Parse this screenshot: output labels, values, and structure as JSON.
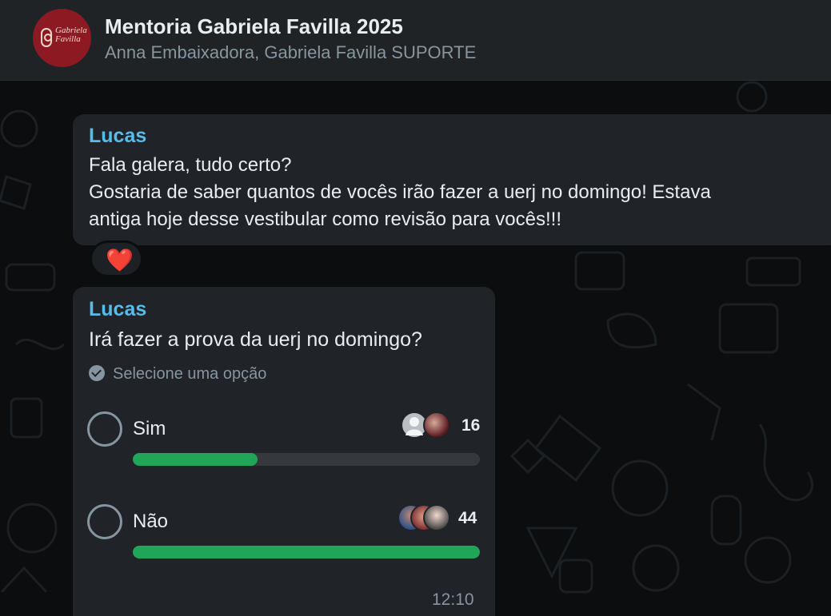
{
  "header": {
    "title": "Mentoria Gabriela Favilla 2025",
    "members": "Anna Embaixadora, Gabriela Favilla SUPORTE",
    "avatar_icon": "group-logo-icon",
    "avatar_text": "Gabriela Favilla",
    "avatar_color": "#8d1a22"
  },
  "messages": [
    {
      "sender": "Lucas",
      "lines": [
        "Fala galera, tudo certo?",
        "Gostaria de saber quantos de vocês irão fazer a uerj no domingo! Estava",
        "antiga hoje desse vestibular como revisão para vocês!!!"
      ],
      "reaction": "❤️"
    },
    {
      "sender": "Lucas",
      "poll": {
        "question": "Irá fazer a prova da uerj no domingo?",
        "hint": "Selecione uma opção",
        "options": [
          {
            "label": "Sim",
            "votes": "16",
            "fraction": 0.36
          },
          {
            "label": "Não",
            "votes": "44",
            "fraction": 1.0
          }
        ]
      },
      "time": "12:10"
    }
  ],
  "colors": {
    "sender": "#53bdeb",
    "poll_bar": "#21a659",
    "bubble": "#202327",
    "background": "#0b0d0e"
  }
}
